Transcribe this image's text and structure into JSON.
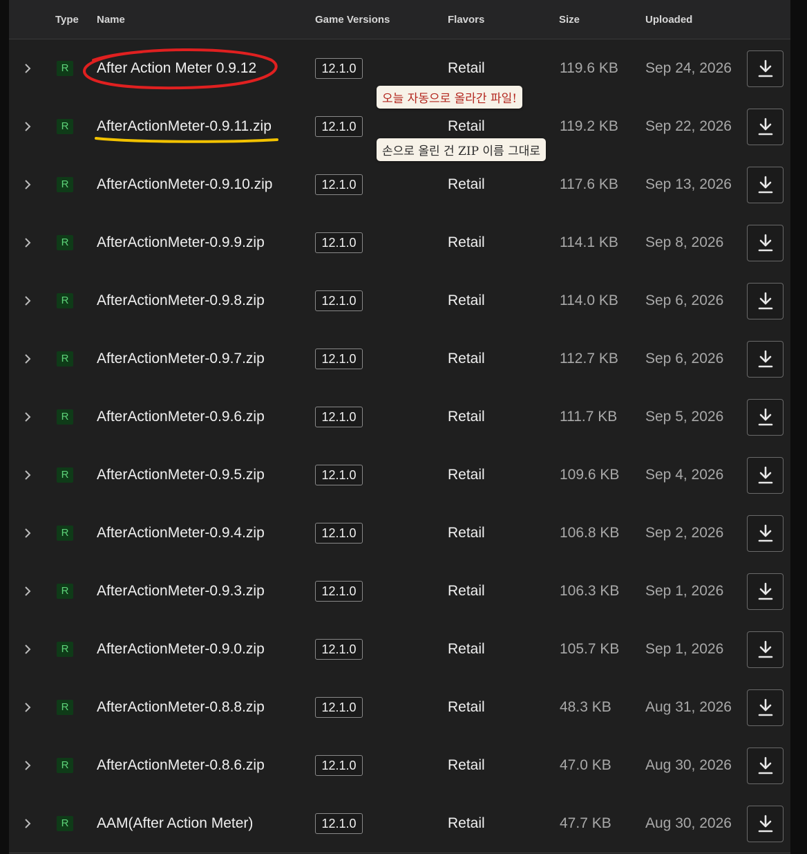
{
  "headers": {
    "type": "Type",
    "name": "Name",
    "versions": "Game Versions",
    "flavors": "Flavors",
    "size": "Size",
    "uploaded": "Uploaded"
  },
  "rows": [
    {
      "type": "R",
      "name": "After Action Meter 0.9.12",
      "version": "12.1.0",
      "flavor": "Retail",
      "size": "119.6 KB",
      "date": "Sep 24, 2026"
    },
    {
      "type": "R",
      "name": "AfterActionMeter-0.9.11.zip",
      "version": "12.1.0",
      "flavor": "Retail",
      "size": "119.2 KB",
      "date": "Sep 22, 2026"
    },
    {
      "type": "R",
      "name": "AfterActionMeter-0.9.10.zip",
      "version": "12.1.0",
      "flavor": "Retail",
      "size": "117.6 KB",
      "date": "Sep 13, 2026"
    },
    {
      "type": "R",
      "name": "AfterActionMeter-0.9.9.zip",
      "version": "12.1.0",
      "flavor": "Retail",
      "size": "114.1 KB",
      "date": "Sep 8, 2026"
    },
    {
      "type": "R",
      "name": "AfterActionMeter-0.9.8.zip",
      "version": "12.1.0",
      "flavor": "Retail",
      "size": "114.0 KB",
      "date": "Sep 6, 2026"
    },
    {
      "type": "R",
      "name": "AfterActionMeter-0.9.7.zip",
      "version": "12.1.0",
      "flavor": "Retail",
      "size": "112.7 KB",
      "date": "Sep 6, 2026"
    },
    {
      "type": "R",
      "name": "AfterActionMeter-0.9.6.zip",
      "version": "12.1.0",
      "flavor": "Retail",
      "size": "111.7 KB",
      "date": "Sep 5, 2026"
    },
    {
      "type": "R",
      "name": "AfterActionMeter-0.9.5.zip",
      "version": "12.1.0",
      "flavor": "Retail",
      "size": "109.6 KB",
      "date": "Sep 4, 2026"
    },
    {
      "type": "R",
      "name": "AfterActionMeter-0.9.4.zip",
      "version": "12.1.0",
      "flavor": "Retail",
      "size": "106.8 KB",
      "date": "Sep 2, 2026"
    },
    {
      "type": "R",
      "name": "AfterActionMeter-0.9.3.zip",
      "version": "12.1.0",
      "flavor": "Retail",
      "size": "106.3 KB",
      "date": "Sep 1, 2026"
    },
    {
      "type": "R",
      "name": "AfterActionMeter-0.9.0.zip",
      "version": "12.1.0",
      "flavor": "Retail",
      "size": "105.7 KB",
      "date": "Sep 1, 2026"
    },
    {
      "type": "R",
      "name": "AfterActionMeter-0.8.8.zip",
      "version": "12.1.0",
      "flavor": "Retail",
      "size": "48.3 KB",
      "date": "Aug 31, 2026"
    },
    {
      "type": "R",
      "name": "AfterActionMeter-0.8.6.zip",
      "version": "12.1.0",
      "flavor": "Retail",
      "size": "47.0 KB",
      "date": "Aug 30, 2026"
    },
    {
      "type": "R",
      "name": "AAM(After Action Meter)",
      "version": "12.1.0",
      "flavor": "Retail",
      "size": "47.7 KB",
      "date": "Aug 30, 2026"
    }
  ],
  "annotations": {
    "note1": "오늘 자동으로 올라간 파일!",
    "note2": "손으로 올린 건 ZIP 이름 그대로"
  },
  "colors": {
    "background": "#1e1e1e",
    "badge_bg": "#0f3b18",
    "badge_text": "#5ed47a",
    "circle_annotation": "#e02020",
    "underline_annotation": "#f2c200"
  },
  "icons": {
    "expand": "chevron-right-icon",
    "download": "download-icon"
  }
}
